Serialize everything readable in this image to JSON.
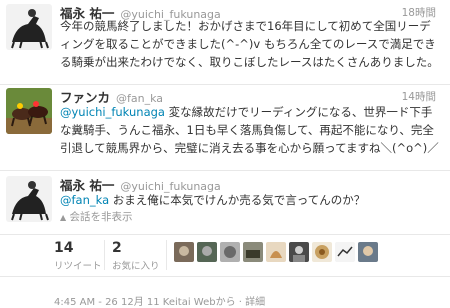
{
  "tweets": [
    {
      "name": "福永 祐一",
      "handle": "@yuichi_fukunaga",
      "time": "18時間",
      "text": "今年の競馬終了しました！おかげさまで16年目にして初めて全国リーディングを取ることができました(^-^)v もちろん全てのレースで満足できる騎乗が出来たわけでなく、取りこぼしたレースはたくさんありました。"
    },
    {
      "name": "ファンカ",
      "handle": "@fan_ka",
      "time": "14時間",
      "mention": "@yuichi_fukunaga",
      "text": " 変な縁故だけでリーディングになる、世界一ド下手な糞騎手、うんこ福永、1日も早く落馬負傷して、再起不能になり、完全引退して競馬界から、完璧に消え去る事を心から願ってますね＼(^o^)／"
    },
    {
      "name": "福永 祐一",
      "handle": "@yuichi_fukunaga",
      "mention": "@fan_ka",
      "text": " おまえ俺に本気でけんか売る気で言ってんのか？",
      "hide_conversation": "会話を非表示"
    }
  ],
  "stats": {
    "retweets_count": "14",
    "retweets_label": "リツイート",
    "favorites_count": "2",
    "favorites_label": "お気に入り"
  },
  "footer": "4:45 AM - 26 12月 11 Keitai Webから · 詳細",
  "colors": {
    "link": "#0084b4",
    "muted": "#999999",
    "text": "#333333"
  }
}
